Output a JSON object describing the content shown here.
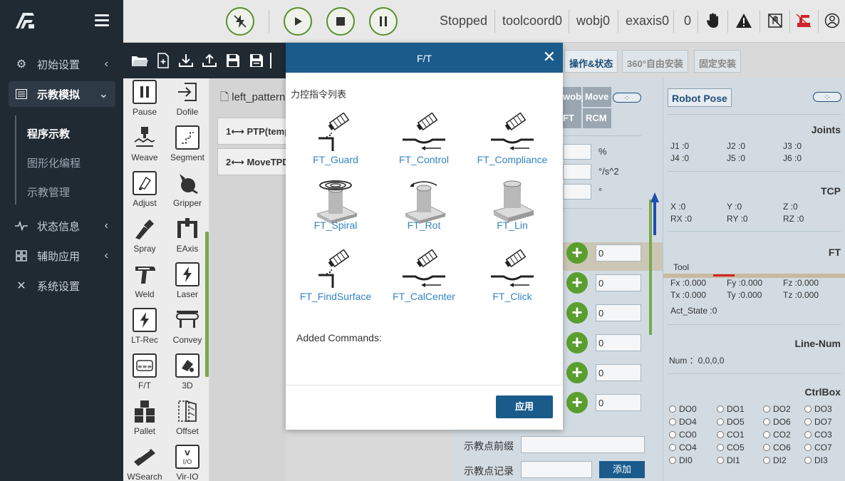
{
  "sidebar": {
    "items": [
      {
        "label": "初始设置",
        "icon": "gear-icon"
      },
      {
        "label": "示教模拟",
        "icon": "list-icon"
      },
      {
        "label": "状态信息",
        "icon": "pulse-icon"
      },
      {
        "label": "辅助应用",
        "icon": "grid-icon"
      },
      {
        "label": "系统设置",
        "icon": "tools-icon"
      }
    ],
    "sub_items": [
      "程序示教",
      "图形化编程",
      "示教管理"
    ]
  },
  "topbar": {
    "status": "Stopped",
    "tool_coord": "toolcoord0",
    "wobj": "wobj0",
    "exaxis": "exaxis0",
    "count": "0"
  },
  "palette": [
    {
      "label": "Pause"
    },
    {
      "label": "Dofile"
    },
    {
      "label": "Weave"
    },
    {
      "label": "Segment"
    },
    {
      "label": "Adjust"
    },
    {
      "label": "Gripper"
    },
    {
      "label": "Spray"
    },
    {
      "label": "EAxis"
    },
    {
      "label": "Weld"
    },
    {
      "label": "Laser"
    },
    {
      "label": "LT-Rec"
    },
    {
      "label": "Convey"
    },
    {
      "label": "F/T"
    },
    {
      "label": "3D"
    },
    {
      "label": "Pallet"
    },
    {
      "label": "Offset"
    },
    {
      "label": "WSearch"
    },
    {
      "label": "Vir-IO"
    }
  ],
  "program": {
    "filename": "left_pattern",
    "lines": [
      "1⟷ PTP(temp",
      "2⟷ MoveTPD"
    ]
  },
  "tabs": [
    "操作&状态",
    "360°自由安装",
    "固定安装"
  ],
  "mid_panel": {
    "tabs": [
      "wobj",
      "Move",
      "FT",
      "RCM"
    ],
    "units": [
      "%",
      "°/s^2",
      "°"
    ],
    "inputs": [
      "0",
      "0",
      "0",
      "0",
      "0",
      "0"
    ]
  },
  "right_panel": {
    "robot_pose": "Robot Pose",
    "joints_title": "Joints",
    "joints": [
      "J1 :0",
      "J2 :0",
      "J3 :0",
      "J4 :0",
      "J5 :0",
      "J6 :0"
    ],
    "tcp_title": "TCP",
    "tcp": [
      "X  :0",
      "Y  :0",
      "Z  :0",
      "RX :0",
      "RY :0",
      "RZ :0"
    ],
    "ft_title": "FT",
    "tool_label": "Tool",
    "ft": [
      "Fx :0.000",
      "Fy :0.000",
      "Fz :0.000",
      "Tx :0.000",
      "Ty :0.000",
      "Tz :0.000"
    ],
    "act_state": "Act_State :0",
    "line_num_title": "Line-Num",
    "line_num": "Num  ：0,0,0,0",
    "ctrlbox_title": "CtrlBox",
    "ctrlbox": [
      "DO0",
      "DO1",
      "DO2",
      "DO3",
      "DO4",
      "DO5",
      "DO6",
      "DO7",
      "CO0",
      "CO1",
      "CO2",
      "CO3",
      "CO4",
      "CO5",
      "CO6",
      "CO7",
      "DI0",
      "DI1",
      "DI2",
      "DI3"
    ]
  },
  "bottom_fields": {
    "prefix_label": "示教点前缀",
    "record_label": "示教点记录",
    "add_button": "添加"
  },
  "modal": {
    "title": "F/T",
    "list_label": "力控指令列表",
    "commands": [
      {
        "label": "FT_Guard"
      },
      {
        "label": "FT_Control"
      },
      {
        "label": "FT_Compliance"
      },
      {
        "label": "FT_Spiral"
      },
      {
        "label": "FT_Rot"
      },
      {
        "label": "FT_Lin"
      },
      {
        "label": "FT_FindSurface"
      },
      {
        "label": "FT_CalCenter"
      },
      {
        "label": "FT_Click"
      }
    ],
    "added_label": "Added Commands:",
    "apply": "应用"
  },
  "colors": {
    "sidebar_bg": "#1f2a33",
    "modal_header": "#1a5b8c",
    "accent_green": "#5a8f2e",
    "link_blue": "#3584c3"
  }
}
